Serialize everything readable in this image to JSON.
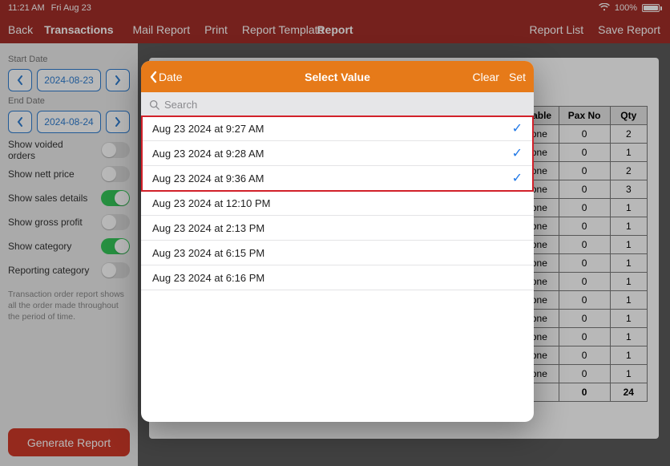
{
  "statusbar": {
    "time": "11:21 AM",
    "date": "Fri Aug 23",
    "battery": "100%"
  },
  "topnav": {
    "back": "Back",
    "trans": "Transactions",
    "mail": "Mail Report",
    "print": "Print",
    "template": "Report Template",
    "title": "Report",
    "list": "Report List",
    "save": "Save Report"
  },
  "sidebar": {
    "start_label": "Start Date",
    "start_date": "2024-08-23",
    "end_label": "End Date",
    "end_date": "2024-08-24",
    "voided": "Show voided orders",
    "nett": "Show nett price",
    "sales": "Show sales details",
    "gross": "Show gross profit",
    "category": "Show category",
    "repcat": "Reporting category",
    "help": "Transaction order report shows all the order made throughout the period of time.",
    "generate": "Generate Report"
  },
  "table": {
    "h1": "Table",
    "h2": "Pax No",
    "h3": "Qty",
    "rows": [
      {
        "t": "one",
        "p": "0",
        "q": "2"
      },
      {
        "t": "one",
        "p": "0",
        "q": "1"
      },
      {
        "t": "one",
        "p": "0",
        "q": "2"
      },
      {
        "t": "one",
        "p": "0",
        "q": "3"
      },
      {
        "t": "one",
        "p": "0",
        "q": "1"
      },
      {
        "t": "one",
        "p": "0",
        "q": "1"
      },
      {
        "t": "one",
        "p": "0",
        "q": "1"
      },
      {
        "t": "one",
        "p": "0",
        "q": "1"
      },
      {
        "t": "one",
        "p": "0",
        "q": "1"
      },
      {
        "t": "one",
        "p": "0",
        "q": "1"
      },
      {
        "t": "one",
        "p": "0",
        "q": "1"
      },
      {
        "t": "one",
        "p": "0",
        "q": "1"
      },
      {
        "t": "one",
        "p": "0",
        "q": "1"
      },
      {
        "t": "one",
        "p": "0",
        "q": "1"
      }
    ],
    "total_p": "0",
    "total_q": "24"
  },
  "popover": {
    "back": "Date",
    "title": "Select Value",
    "clear": "Clear",
    "set": "Set",
    "search_placeholder": "Search",
    "items": [
      {
        "label": "Aug 23 2024 at 9:27 AM",
        "checked": true
      },
      {
        "label": "Aug 23 2024 at 9:28 AM",
        "checked": true
      },
      {
        "label": "Aug 23 2024 at 9:36 AM",
        "checked": true
      },
      {
        "label": "Aug 23 2024 at 12:10 PM",
        "checked": false
      },
      {
        "label": "Aug 23 2024 at 2:13 PM",
        "checked": false
      },
      {
        "label": "Aug 23 2024 at 6:15 PM",
        "checked": false
      },
      {
        "label": "Aug 23 2024 at 6:16 PM",
        "checked": false
      }
    ]
  }
}
